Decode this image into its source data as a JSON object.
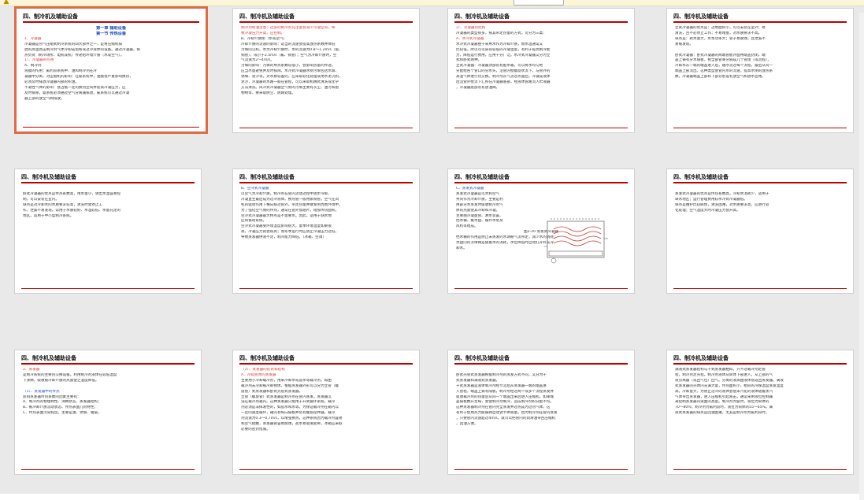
{
  "app": {
    "accent_color": "#e06a43",
    "header_line_color": "#c00000",
    "topbar_icon": "warning-icon"
  },
  "slides": [
    {
      "header": "四、制冷机及辅助设备",
      "lines": [
        {
          "t": "第一章 辅助设备",
          "s": "blue title c"
        },
        {
          "t": "第一节 传热设备",
          "s": "blue title c"
        },
        {
          "t": "1、冷凝器",
          "s": "red"
        },
        {
          "t": "冷凝器是热气压缩式制冷系统的四大部件之一，是将压缩机排",
          "s": ""
        },
        {
          "t": "放的高温高压制冷剂气体冷却成饱和或过冷液体的设备。通过冷凝器，将",
          "s": ""
        },
        {
          "t": "热负荷（制冷场所、电机或机）传递给环境介质（水或空气）。",
          "s": ""
        },
        {
          "t": "1）、冷凝器的作用",
          "s": "red"
        },
        {
          "t": "A、制冷剂",
          "s": ""
        },
        {
          "t": "液膜的作用：氟利昂系统中、油和制冷剂在冷",
          "s": ""
        },
        {
          "t": "凝器中分离，对压缩机的影响：在氨系统中，油膜会严重影响换热，",
          "s": ""
        },
        {
          "t": "必须及时排放冷凝器内部的积油。",
          "s": ""
        },
        {
          "t": "不凝性气体的影响：会占据一定的换热空间并提高冷凝压力，应",
          "s": ""
        },
        {
          "t": "及时排除。氨系统必须通过空气分离器排放，氟系统可以通过冷凝",
          "s": ""
        },
        {
          "t": "器上部的放空气阀排放。",
          "s": ""
        }
      ]
    },
    {
      "header": "四、制冷机及辅助设备",
      "lines": [
        {
          "t": "制冷剂和油注意：过多的制冷剂充注量会减少冷凝空间，导",
          "s": "red"
        },
        {
          "t": "致冷凝压力升高，应控制。",
          "s": "red"
        },
        {
          "t": "B、冷却介质侧（水或空气）",
          "s": ""
        },
        {
          "t": "冷却介质的流速的影响：适当的流速会提高放热系数并降低",
          "s": ""
        },
        {
          "t": "污垢的沉积。水为冷却介质时，水的流速为0.8～1.2m/s（氨、",
          "s": ""
        },
        {
          "t": "铜管），或小于2.5m/s（氟、铜管）；空气为冷却介质时，空",
          "s": ""
        },
        {
          "t": "气流速为2～4m/s。",
          "s": ""
        },
        {
          "t": "污垢的影响：污垢的导热系数较低小，会影响热量的传递，",
          "s": ""
        },
        {
          "t": "应当尽量避免并及时排除。水冷式冷凝器水侧污垢包括水垢、",
          "s": ""
        },
        {
          "t": "锈垢、泥沙等，对水质较差的，应采取软化处理或用水泥沉积，",
          "s": ""
        },
        {
          "t": "泥沙，冷凝器的水路一般在管程，可以采取机械式清洗或化学",
          "s": ""
        },
        {
          "t": "方法清洗。风冷式冷凝器空气侧的污垢主要有灰尘、油污和脂",
          "s": ""
        },
        {
          "t": "物物等，要采取防尘、防腐处理。",
          "s": ""
        }
      ]
    },
    {
      "header": "四、制冷机及辅助设备",
      "lines": [
        {
          "t": "2）、冷凝器的结构",
          "s": "red"
        },
        {
          "t": "冷凝器的类型很多，按其带走热量的方式，可分为三类：",
          "s": ""
        },
        {
          "t": "A、水冷式冷凝器",
          "s": "red"
        },
        {
          "t": "水冷式冷凝器由于采用水作为冷却介质，而水温通常又",
          "s": ""
        },
        {
          "t": "比较低，所以可以获得较低的冷凝温度，有利于提高制冷能",
          "s": ""
        },
        {
          "t": "力，降低运行费用。应用十分广泛。水冷式冷凝器又分为立",
          "s": ""
        },
        {
          "t": "式和卧式两种。",
          "s": ""
        },
        {
          "t": "立式冷凝器：冷凝器顶部装有配水箱，可以将水均匀地",
          "s": ""
        },
        {
          "t": "分配给各个管口的分水头，沿管内壁螺旋状流下，与管外的",
          "s": ""
        },
        {
          "t": "高温气体进行热交换。制冷剂从气流过热量后，冷凝成液体",
          "s": ""
        },
        {
          "t": "后沿管外壁流下汇积在冷凝器底部，经液体管路流入贮液器",
          "s": ""
        },
        {
          "t": "，冷凝器底部装有放油阀。",
          "s": ""
        }
      ]
    },
    {
      "header": "四、制冷机及辅助设备",
      "lines": [
        {
          "t": "立式冷凝器的优点是：占地面积小，可以安装在室外；易",
          "s": ""
        },
        {
          "t": "清洗，且不必停止工作；不易堵塞，对水质要求不高。",
          "s": ""
        },
        {
          "t": "缺点是：耗水量大，水泵功率大；管子易腐蚀，且泄漏不",
          "s": ""
        },
        {
          "t": "易被发现。",
          "s": ""
        },
        {
          "t": "",
          "s": ""
        },
        {
          "t": "卧式冷凝器：卧式冷凝器的两端管板外面用端盖封闭，端",
          "s": ""
        },
        {
          "t": "盖上铸有分水隔板，把全部管束分隔成几个管组（或流程），",
          "s": ""
        },
        {
          "t": "冷却水从一端的端盖进入后，顺序流过每个流程，最后从同一",
          "s": ""
        },
        {
          "t": "端盖上部流出。这种类型使管内水的流速，提高水侧的放热系",
          "s": ""
        },
        {
          "t": "数。冷凝器端盖上部和下部分别设有放空气和放水丝堵。",
          "s": ""
        }
      ]
    },
    {
      "header": "四、制冷机及辅助设备",
      "lines": [
        {
          "t": "",
          "s": ""
        },
        {
          "t": "卧式冷凝器的优点是传热系数高，用水量小，进出水温容易控",
          "s": ""
        },
        {
          "t": "制，可以安装在室内。",
          "s": ""
        },
        {
          "t": "缺点是对冷却水的水质要求较高，清洗时需停止工",
          "s": ""
        },
        {
          "t": "作，泄漏不易发现。常用于水质较好、水温较低、水量充足的",
          "s": ""
        },
        {
          "t": "地区。适用于中小型制冷系统。",
          "s": ""
        }
      ]
    },
    {
      "header": "四、制冷机及辅助设备",
      "lines": [
        {
          "t": "B、空冷式冷凝器",
          "s": "blue"
        },
        {
          "t": "以空气为冷却介质。制冷剂在管内流动过程中逐步冷却、",
          "s": ""
        },
        {
          "t": "冷凝直至最后成为过冷液体。换热管一般用紫铜管，空气在风",
          "s": ""
        },
        {
          "t": "机的驱动作用下横向掠过管外，带走热量并散发到周围环境中。",
          "s": ""
        },
        {
          "t": "为了强化空气侧的传热，通常在管外加翅片，增加传热面积。",
          "s": ""
        },
        {
          "t": "空冷式冷凝器最大特点是不需要水。因此，适用于缺水地",
          "s": ""
        },
        {
          "t": "区和振动系统。",
          "s": ""
        },
        {
          "t": "空冷式冷凝器受环境温度影响很大。夏季环境温度如果很",
          "s": ""
        },
        {
          "t": "高，冷凝压力就会很高；而冬季运行时应防止冷凝压力过低，",
          "s": ""
        },
        {
          "t": "导致蒸发器供液不足，制冷能力降低。（冰箱、空调）",
          "s": ""
        }
      ]
    },
    {
      "header": "四、制冷机及辅助设备",
      "lines": [
        {
          "t": "C、蒸发式冷凝器",
          "s": "blue"
        },
        {
          "t": "蒸发式冷凝器是以水和空气",
          "s": ""
        },
        {
          "t": "共同作为冷却介质，主要是利",
          "s": ""
        },
        {
          "t": "用部分水蒸发时吸收制冷剂气",
          "s": ""
        },
        {
          "t": "体的热量使其冷却和冷凝。",
          "s": ""
        },
        {
          "t": "主要由冷凝盘管、淋水装置、",
          "s": ""
        },
        {
          "t": "挡水栅、集水盘、循环水泵及",
          "s": ""
        },
        {
          "t": "风机等组成。",
          "s": ""
        },
        {
          "t": "图2-20 蒸发式冷凝器",
          "s": "c"
        },
        {
          "t": "挡水栅的作用是防止未蒸发的水滴被气流带走，减少水的消耗；",
          "s": ""
        },
        {
          "t": "水盘内的浮球阀是随着水的消耗，水位降低时自动打开补充冷",
          "s": ""
        },
        {
          "t": "却水。",
          "s": ""
        }
      ]
    },
    {
      "header": "四、制冷机及辅助设备",
      "lines": [
        {
          "t": "",
          "s": ""
        },
        {
          "t": "蒸发式冷凝器的优点是传热系数高，冷却水消耗少，适用于",
          "s": ""
        },
        {
          "t": "缺水地区；运行管理费用较水冷式冷凝器低。",
          "s": ""
        },
        {
          "t": "缺点是维护比较麻烦，清洗困难，对水质要求高，应进行软",
          "s": ""
        },
        {
          "t": "化处理；空气湿度大时冷凝压力会升高。",
          "s": ""
        }
      ]
    },
    {
      "header": "四、制冷机及辅助设备",
      "lines": [
        {
          "t": "2、蒸发器",
          "s": "red"
        },
        {
          "t": "是制冷系统的主要热交换设备。利用制冷剂液体在较低温度",
          "s": ""
        },
        {
          "t": "下沸腾，吸收被冷却介质的热量使之温度降低。",
          "s": ""
        },
        {
          "t": "",
          "s": ""
        },
        {
          "t": "（1）、蒸发器中的传热",
          "s": "blue"
        },
        {
          "t": "影响蒸发器传热系数的因素主要有：",
          "s": ""
        },
        {
          "t": "A、制冷剂的物理特性、沸腾状态、蒸发器结构；",
          "s": ""
        },
        {
          "t": "B、被冷却介质流动状态、传热表面几何特性；",
          "s": ""
        },
        {
          "t": "C、传热表面污染程度，主要是油、锈垢、霜层。",
          "s": ""
        }
      ]
    },
    {
      "header": "四、制冷机及辅助设备",
      "lines": [
        {
          "t": "（2）、蒸发器的形式和结构",
          "s": "red"
        },
        {
          "t": "A、冷却液体的蒸发器",
          "s": "red"
        },
        {
          "t": "主要用于冷却载冷剂，用来冷却水或盐水等载冷剂，再由",
          "s": ""
        },
        {
          "t": "载冷剂去冷却被冷却物体。根据蒸发器外形可以分为立管（螺",
          "s": ""
        },
        {
          "t": "旋管）式蒸发器和卧式壳管式蒸发器。",
          "s": ""
        },
        {
          "t": "立管（螺旋管）式蒸发器是制冷剂在管内蒸发，蒸发器沉",
          "s": ""
        },
        {
          "t": "浸在载冷剂箱内。这种蒸发器只能用于开式循环系统，载冷",
          "s": ""
        },
        {
          "t": "剂必须是非挥发性的，如盐水和水等。为保证载冷剂在箱内以",
          "s": ""
        },
        {
          "t": "一定的速度循环，箱内有纵向隔板并装有螺旋搅拌器。载冷",
          "s": ""
        },
        {
          "t": "剂流速为0.3～0.7m/s，以增强换热。这种系统因为载冷剂容易",
          "s": ""
        },
        {
          "t": "和空气接触，蒸发器管容易腐蚀，盐水易吸潮变稀，冰箱应采取",
          "s": ""
        },
        {
          "t": "必要的密封措施。",
          "s": ""
        }
      ]
    },
    {
      "header": "四、制冷机及辅助设备",
      "lines": [
        {
          "t": "",
          "s": ""
        },
        {
          "t": "卧式壳管式蒸发器根据制冷剂的蒸发方式不同，又分为干",
          "s": ""
        },
        {
          "t": "式蒸发器和满液式蒸发器。",
          "s": ""
        },
        {
          "t": "干式蒸发器是液体制冷剂经节流后从蒸发器一端的端盖进",
          "s": ""
        },
        {
          "t": "入管程，端盖上铸有隔板，制冷剂经过两个或多个流程蒸发并",
          "s": ""
        },
        {
          "t": "吸收载冷剂的热量后从同一个端盖出来后进入压缩机。如果端",
          "s": ""
        },
        {
          "t": "盖隔板数升至每，会使制冷剂制冷，造成制冷剂积分配不均。",
          "s": ""
        },
        {
          "t": "这种蒸发器制冷剂在管内完全蒸发并过热成为过热气体。这",
          "s": ""
        },
        {
          "t": "有利于使用热力膨胀阀自动调节供液量。因为制冷剂在管内蒸发",
          "s": ""
        },
        {
          "t": "，只要管内流速超过4m/s，就可以把管内的润滑油带回压缩机",
          "s": ""
        },
        {
          "t": "，回油方便。",
          "s": ""
        }
      ]
    },
    {
      "header": "四、制冷机及辅助设备",
      "lines": [
        {
          "t": "满液式蒸发器结构与干式蒸发器相似，只不过载冷剂走管",
          "s": ""
        },
        {
          "t": "程，制冷剂走壳程。制冷剂液体从筒体下部进入，从上部的气",
          "s": ""
        },
        {
          "t": "液分离器（或回气包）回气。分离的液滴由液体管返回蒸发器。满液",
          "s": ""
        },
        {
          "t": "式蒸发器的壳体内充满大量，传热面积小，相同的冷媒温度蒸发温度",
          "s": ""
        },
        {
          "t": "高。冷却量大，为防止过冷的液体会使未汽化的液体随着蒸汽",
          "s": ""
        },
        {
          "t": "气体带出蒸发器，进入压缩机引起液击，通常采用液位控制器",
          "s": ""
        },
        {
          "t": "来控制蒸发器内液面的高度。制冷剂为氨时，液位为筒体的",
          "s": ""
        },
        {
          "t": "70～80%；制冷剂为氟利昂时，液位为筒体的55～65%。满",
          "s": ""
        },
        {
          "t": "液式蒸发器的缺点是回油困难，尤其是制冷剂为氟利昂时。",
          "s": ""
        }
      ]
    }
  ]
}
